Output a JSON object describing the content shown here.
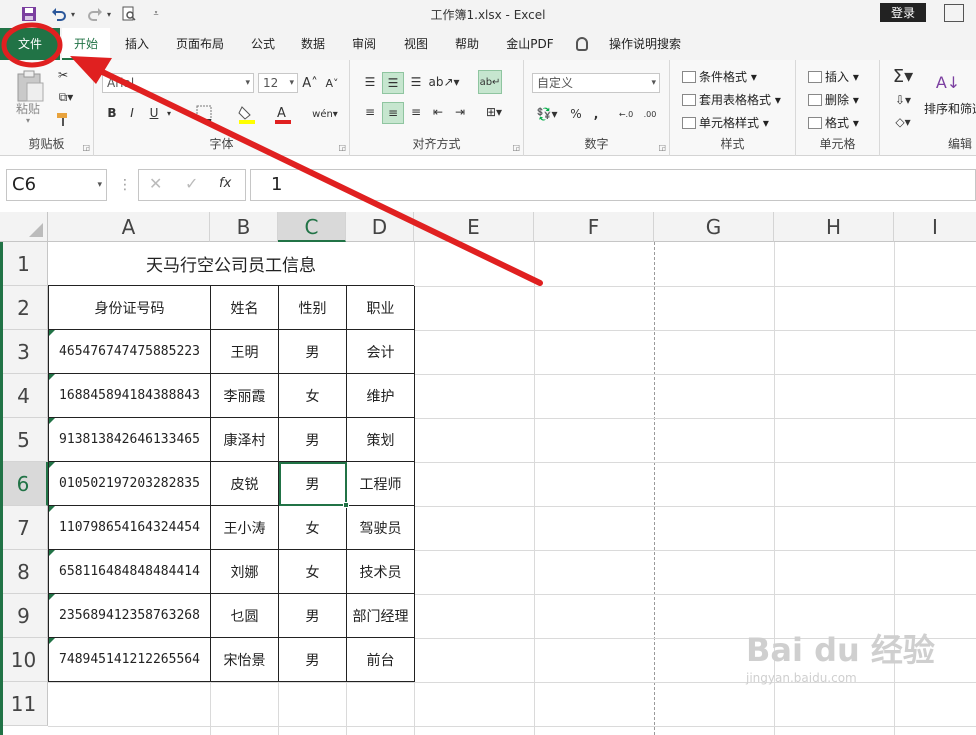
{
  "window": {
    "title": "工作簿1.xlsx  -  Excel",
    "login": "登录"
  },
  "tabs": [
    "文件",
    "开始",
    "插入",
    "页面布局",
    "公式",
    "数据",
    "审阅",
    "视图",
    "帮助",
    "金山PDF",
    "操作说明搜索"
  ],
  "ribbon": {
    "clipboard": {
      "label": "剪贴板",
      "paste": "粘贴"
    },
    "font": {
      "label": "字体",
      "name": "Arial",
      "size": "12",
      "bold": "B",
      "italic": "I",
      "underline": "U"
    },
    "alignment": {
      "label": "对齐方式"
    },
    "number": {
      "label": "数字",
      "format": "自定义",
      "percent": "%",
      "comma": ",",
      "dec_inc": "←.0\n.00",
      "dec_dec": ".00\n→.0"
    },
    "styles": {
      "label": "样式",
      "cond": "条件格式",
      "table": "套用表格格式",
      "cell": "单元格样式"
    },
    "cells": {
      "label": "单元格",
      "insert": "插入",
      "delete": "删除",
      "format": "格式"
    },
    "editing": {
      "label": "编辑",
      "sort": "排序和筛选"
    }
  },
  "formula_bar": {
    "name_box": "C6",
    "value": "1"
  },
  "columns": [
    "A",
    "B",
    "C",
    "D",
    "E",
    "F",
    "G",
    "H",
    "I"
  ],
  "rows": [
    "1",
    "2",
    "3",
    "4",
    "5",
    "6",
    "7",
    "8",
    "9",
    "10",
    "11"
  ],
  "selected": {
    "column": "C",
    "row": "6"
  },
  "sheet": {
    "title": "天马行空公司员工信息",
    "headers": [
      "身份证号码",
      "姓名",
      "性别",
      "职业"
    ],
    "rows": [
      [
        "465476747475885223",
        "王明",
        "男",
        "会计"
      ],
      [
        "168845894184388843",
        "李丽霞",
        "女",
        "维护"
      ],
      [
        "913813842646133465",
        "康泽村",
        "男",
        "策划"
      ],
      [
        "010502197203282835",
        "皮锐",
        "男",
        "工程师"
      ],
      [
        "110798654164324454",
        "王小涛",
        "女",
        "驾驶员"
      ],
      [
        "658116484848484414",
        "刘娜",
        "女",
        "技术员"
      ],
      [
        "235689412358763268",
        "乜圆",
        "男",
        "部门经理"
      ],
      [
        "748945141212265564",
        "宋怡景",
        "男",
        "前台"
      ]
    ]
  },
  "watermark": {
    "brand": "Bai du 经验",
    "url": "jingyan.baidu.com"
  },
  "colors": {
    "excel_green": "#217346",
    "annotation_red": "#e02020"
  }
}
